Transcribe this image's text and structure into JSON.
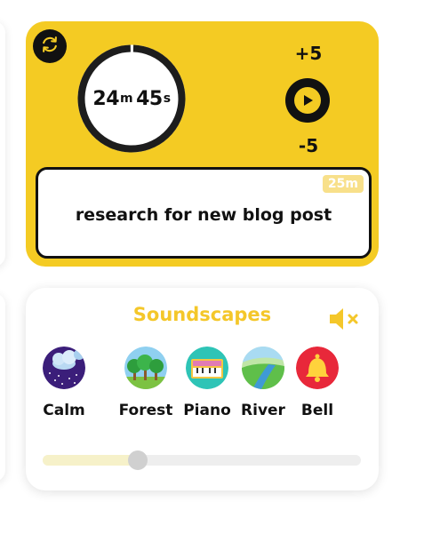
{
  "timer": {
    "minutes": "24",
    "minutes_unit": "m",
    "seconds": "45",
    "seconds_unit": "s",
    "progress": 0.99,
    "plus_label": "+5",
    "minus_label": "-5",
    "task_text": "research for new blog post",
    "duration_badge": "25m",
    "accent_color": "#f4cb23",
    "icons": {
      "reset": "refresh-icon",
      "play": "play-icon"
    }
  },
  "sounds": {
    "title": "Soundscapes",
    "title_color": "#f4c72a",
    "mute_icon": "speaker-muted-icon",
    "items": [
      {
        "label": "Calm",
        "icon": "calm-night-icon"
      },
      {
        "label": "Forest",
        "icon": "forest-icon"
      },
      {
        "label": "Piano",
        "icon": "piano-icon"
      },
      {
        "label": "River",
        "icon": "river-icon"
      },
      {
        "label": "Bell",
        "icon": "bell-icon"
      }
    ],
    "volume": 0.3
  }
}
